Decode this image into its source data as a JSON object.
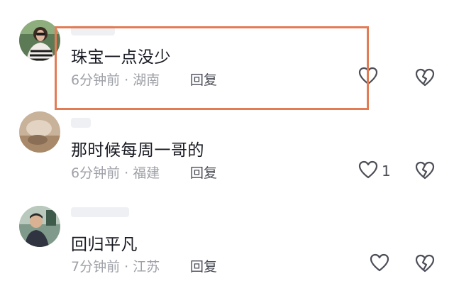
{
  "comments": [
    {
      "text": "珠宝一点没少",
      "time": "6分钟前",
      "separator": "·",
      "location": "湖南",
      "reply_label": "回复",
      "like_count": ""
    },
    {
      "text": "那时候每周一哥的",
      "time": "6分钟前",
      "separator": "·",
      "location": "福建",
      "reply_label": "回复",
      "like_count": "1"
    },
    {
      "text": "回归平凡",
      "time": "7分钟前",
      "separator": "·",
      "location": "江苏",
      "reply_label": "回复",
      "like_count": ""
    }
  ],
  "colors": {
    "highlight_border": "#e37b55",
    "text": "#181a22",
    "meta": "#9fa1a8",
    "icon": "#4c4e57"
  },
  "icons": {
    "like": "heart-outline-icon",
    "dislike": "broken-heart-icon"
  }
}
